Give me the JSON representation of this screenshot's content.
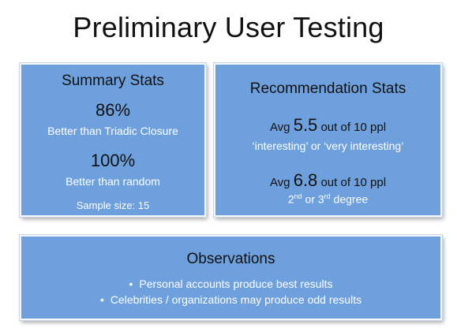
{
  "title": "Preliminary User Testing",
  "summary": {
    "heading": "Summary Stats",
    "stat1_value": "86%",
    "stat1_label": "Better than Triadic Closure",
    "stat2_value": "100%",
    "stat2_label": "Better than random",
    "sample": "Sample size: 15"
  },
  "recommendation": {
    "heading": "Recommendation Stats",
    "line1_prefix": "Avg",
    "line1_value": "5.5",
    "line1_suffix": "out of 10 ppl",
    "line1_sub": "‘interesting’ or ‘very interesting’",
    "line2_prefix": "Avg",
    "line2_value": "6.8",
    "line2_suffix": "out of 10 ppl",
    "line2_sub_a": "2",
    "line2_sub_a_sup": "nd",
    "line2_sub_b": " or 3",
    "line2_sub_b_sup": "rd",
    "line2_sub_c": " degree"
  },
  "observations": {
    "heading": "Observations",
    "items": [
      "Personal accounts produce best results",
      "Celebrities / organizations may produce odd results"
    ]
  },
  "colors": {
    "panel": "#6da0dc",
    "heading_text": "#111111",
    "body_text": "#ffffff"
  }
}
